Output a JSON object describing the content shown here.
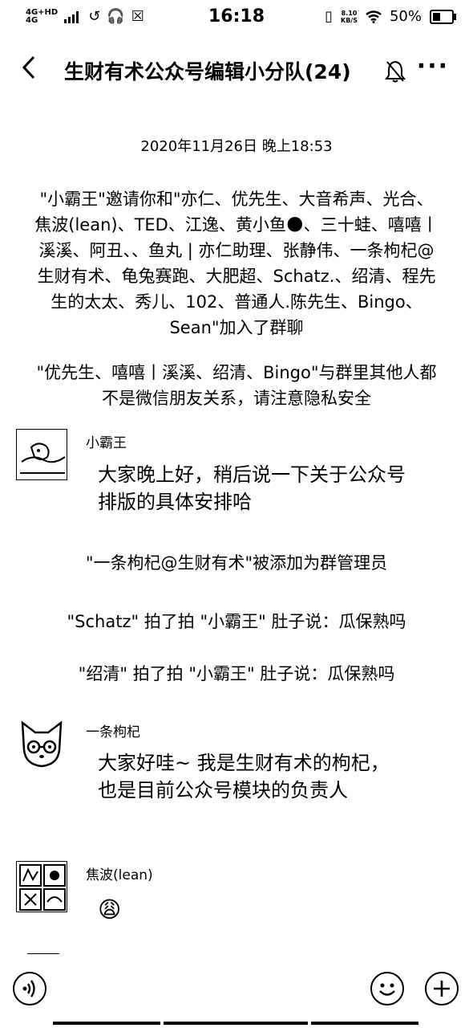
{
  "status_bar": {
    "network_label": "4G+HD",
    "signal_label": "4G",
    "time": "16:18",
    "net_speed_value": "8.10",
    "net_speed_unit": "KB/S",
    "battery_text": "50%",
    "battery_level": 0.5
  },
  "header": {
    "back_label": "<",
    "title": "生财有术公众号编辑小分队(24)",
    "more_label": "···"
  },
  "chat": {
    "timestamp": "2020年11月26日 晚上18:53",
    "system_invite": "\"小霸王\"邀请你和\"亦仁、优先生、大音希声、光合、焦波(lean)、TED、江逸、黄小鱼🌑、三十蛙、嘻嘻丨溪溪、阿丑、、鱼丸 | 亦仁助理、张静伟、一条枸杞@生财有术、龟兔赛跑、大肥超、Schatz.、绍清、程先生的太太、秀儿、102、普通人.陈先生、Bingo、Sean\"加入了群聊",
    "system_privacy": "\"优先生、嘻嘻丨溪溪、绍清、Bingo\"与群里其他人都不是微信朋友关系，请注意隐私安全",
    "messages": [
      {
        "sender": "小霸王",
        "text": "大家晚上好，稍后说一下关于公众号排版的具体安排哈"
      },
      {
        "sender": "一条枸杞",
        "text": "大家好哇~ 我是生财有术的枸杞，也是目前公众号模块的负责人"
      },
      {
        "sender": "焦波(lean)",
        "text": "😩"
      }
    ],
    "system_admin": "\"一条枸杞@生财有术\"被添加为群管理员",
    "system_pat_1": "\"Schatz\" 拍了拍 \"小霸王\" 肚子说：瓜保熟吗",
    "system_pat_2": "\"绍清\" 拍了拍 \"小霸王\" 肚子说：瓜保熟吗"
  },
  "icons": {
    "back": "chevron-left-icon",
    "mute": "bell-muted-icon",
    "more": "more-icon",
    "voice": "voice-icon",
    "emoji": "emoji-icon",
    "plus": "plus-icon"
  }
}
